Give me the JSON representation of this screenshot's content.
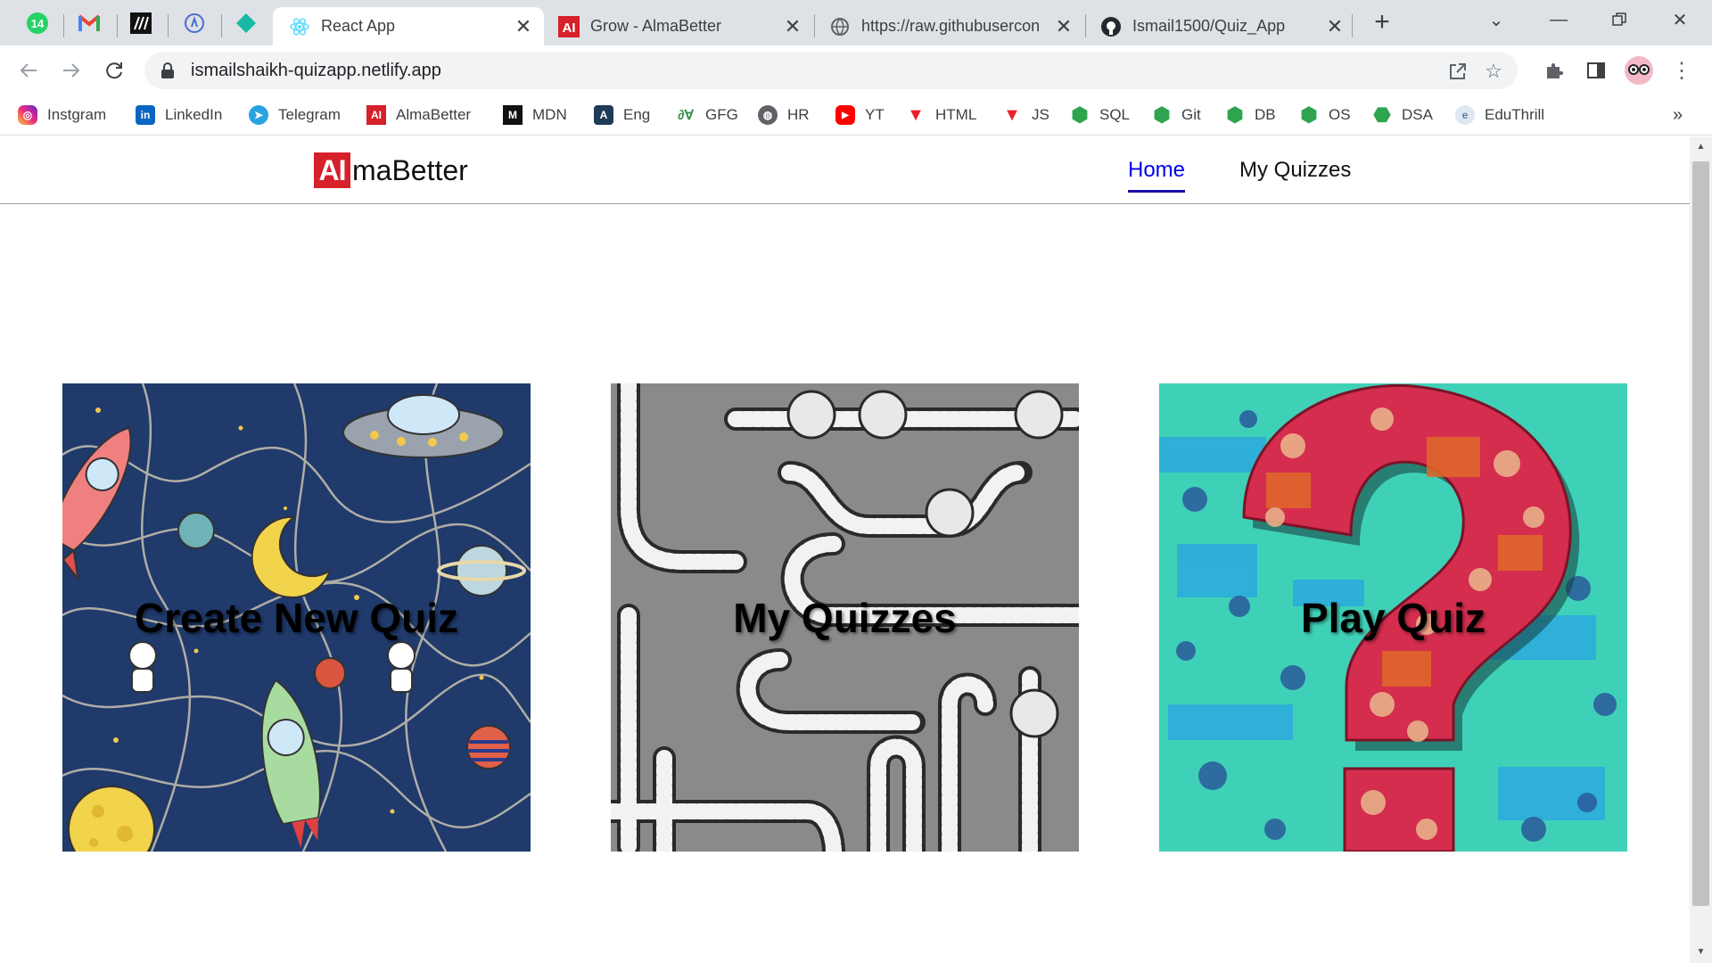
{
  "browser": {
    "pinned_tabs": [
      {
        "icon": "whatsapp-icon",
        "badge": "14"
      },
      {
        "icon": "gmail-icon"
      },
      {
        "icon": "mdn-icon"
      },
      {
        "icon": "react-dev-icon"
      },
      {
        "icon": "diamond-icon"
      }
    ],
    "tabs": [
      {
        "title": "React App",
        "icon": "react-icon",
        "active": true
      },
      {
        "title": "Grow - AlmaBetter",
        "icon": "almabetter-icon"
      },
      {
        "title": "https://raw.githubusercon",
        "icon": "globe-icon"
      },
      {
        "title": "Ismail1500/Quiz_App",
        "icon": "github-icon"
      }
    ],
    "url": "ismailshaikh-quizapp.netlify.app",
    "bookmarks": [
      {
        "label": "Instgram",
        "icon": "instagram-icon",
        "color": "#d62976"
      },
      {
        "label": "LinkedIn",
        "icon": "linkedin-icon",
        "color": "#0a66c2"
      },
      {
        "label": "Telegram",
        "icon": "telegram-icon",
        "color": "#2aa3e0"
      },
      {
        "label": "AlmaBetter",
        "icon": "almabetter-icon",
        "color": "#d6202a"
      },
      {
        "label": "MDN",
        "icon": "mdn-icon",
        "color": "#111111"
      },
      {
        "label": "Eng",
        "icon": "translate-icon",
        "color": "#1f3b57"
      },
      {
        "label": "GFG",
        "icon": "gfg-icon",
        "color": "#2f8d46"
      },
      {
        "label": "HR",
        "icon": "globe-icon",
        "color": "#5f6368"
      },
      {
        "label": "YT",
        "icon": "youtube-icon",
        "color": "#ff0000"
      },
      {
        "label": "HTML",
        "icon": "w3-icon",
        "color": "#e8202a"
      },
      {
        "label": "JS",
        "icon": "w3-icon",
        "color": "#e8202a"
      },
      {
        "label": "SQL",
        "icon": "hexagon-icon",
        "color": "#2ea44f"
      },
      {
        "label": "Git",
        "icon": "hexagon-icon",
        "color": "#2ea44f"
      },
      {
        "label": "DB",
        "icon": "hexagon-icon",
        "color": "#2ea44f"
      },
      {
        "label": "OS",
        "icon": "hexagon-icon",
        "color": "#2ea44f"
      },
      {
        "label": "DSA",
        "icon": "dsa-icon",
        "color": "#2ea44f"
      },
      {
        "label": "EduThrill",
        "icon": "eduthrill-icon",
        "color": "#5a7fa6"
      }
    ]
  },
  "app": {
    "logo": {
      "mark": "AI",
      "word": "maBetter"
    },
    "nav": {
      "home": "Home",
      "my_quizzes": "My Quizzes"
    },
    "cards": [
      {
        "label": "Create New Quiz",
        "theme": "space-doodle",
        "color": "#1f3a6b"
      },
      {
        "label": "My Quizzes",
        "theme": "rope-maze",
        "color": "#8a8a8a"
      },
      {
        "label": "Play Quiz",
        "theme": "question-mark",
        "color": "#3fd1b8"
      }
    ]
  }
}
